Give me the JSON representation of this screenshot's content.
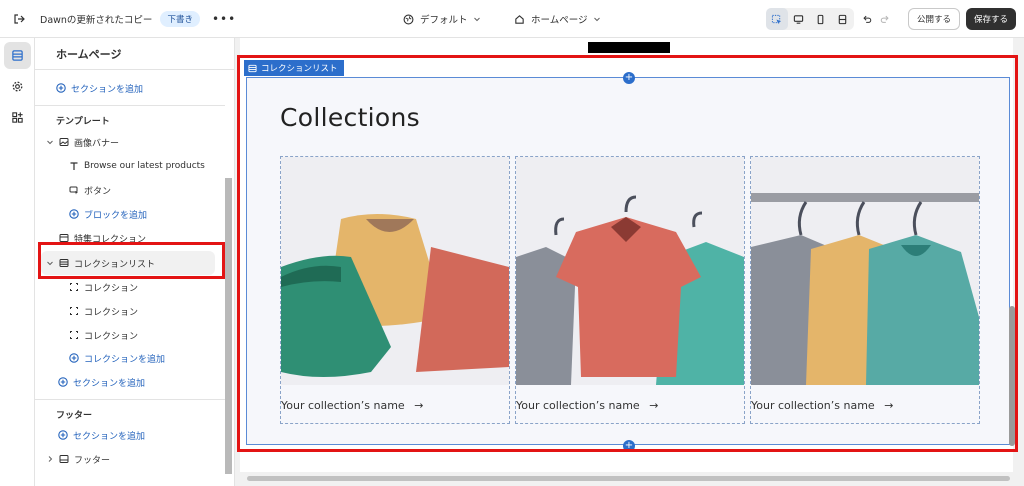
{
  "topbar": {
    "theme_name": "Dawnの更新されたコピー",
    "status_badge": "下書き",
    "more": "•••",
    "theme_selector": "デフォルト",
    "page_selector": "ホームページ",
    "publish_label": "公開する",
    "save_label": "保存する"
  },
  "sidebar": {
    "title": "ホームページ",
    "add_section_top": "セクションを追加",
    "template_heading": "テンプレート",
    "image_banner": "画像バナー",
    "banner_text": "Browse our latest products",
    "banner_button": "ボタン",
    "add_block": "ブロックを追加",
    "featured_collection": "特集コレクション",
    "collection_list": "コレクションリスト",
    "collection_items": [
      "コレクション",
      "コレクション",
      "コレクション"
    ],
    "add_collection": "コレクションを追加",
    "add_section_template": "セクションを追加",
    "footer_heading": "フッター",
    "add_section_footer": "セクションを追加",
    "footer_item": "フッター"
  },
  "preview": {
    "section_label": "コレクションリスト",
    "heading": "Collections",
    "cards": [
      {
        "name": "Your collection’s name",
        "arrow": "→"
      },
      {
        "name": "Your collection’s name",
        "arrow": "→"
      },
      {
        "name": "Your collection’s name",
        "arrow": "→"
      }
    ]
  },
  "colors": {
    "accent": "#2c6ecb",
    "highlight": "#e31414",
    "link": "#2463bc"
  }
}
